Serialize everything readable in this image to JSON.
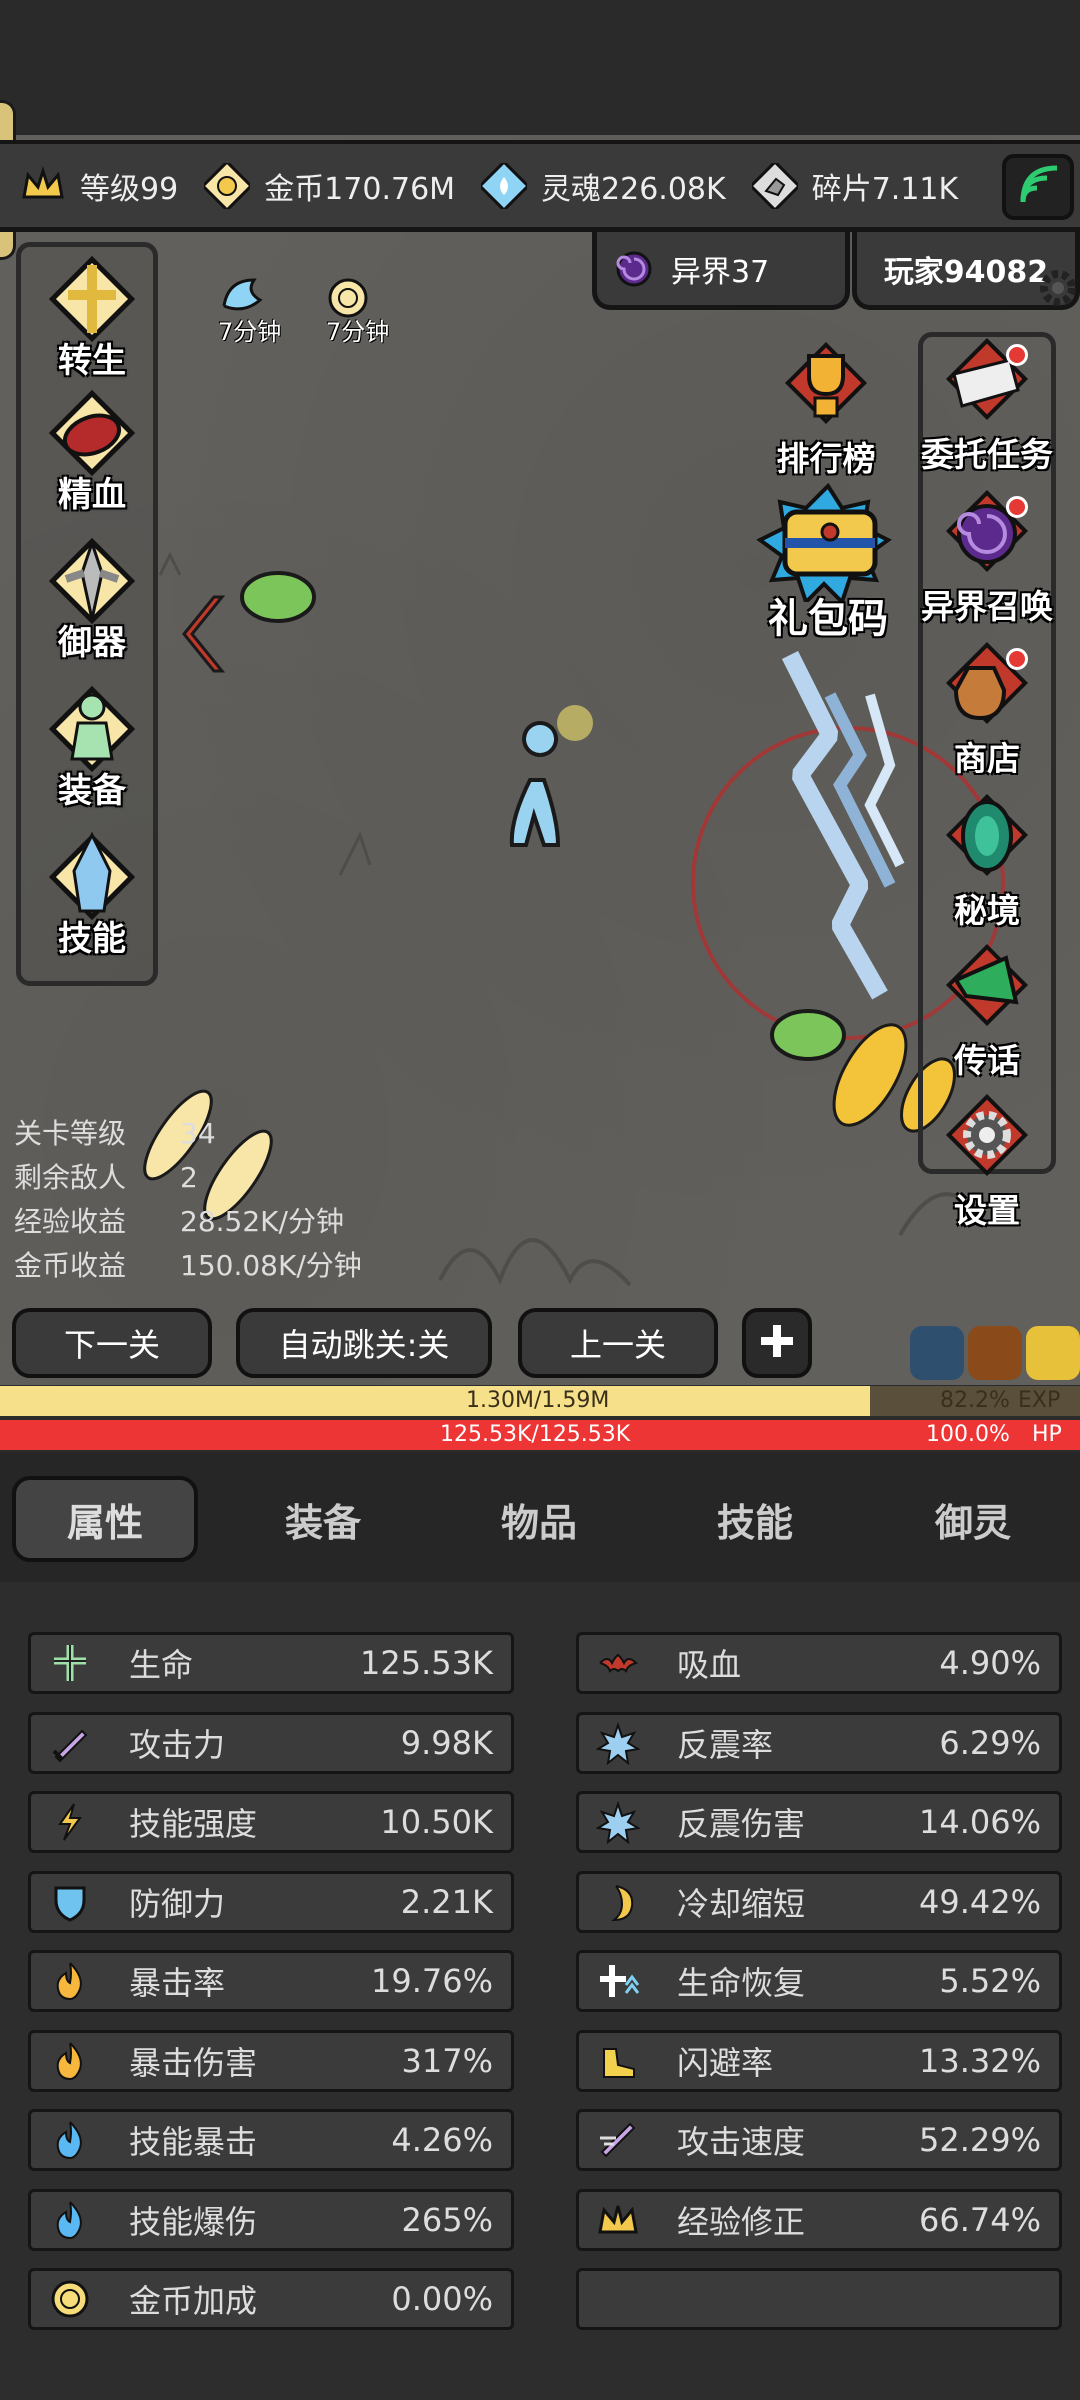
{
  "resources": {
    "level": "等级99",
    "gold": "金币170.76M",
    "soul": "灵魂226.08K",
    "shard": "碎片7.11K"
  },
  "realm_tab": "异界37",
  "player_tab": "玩家94082",
  "timers": [
    "7分钟",
    "7分钟"
  ],
  "left_menu": [
    "转生",
    "精血",
    "御器",
    "装备",
    "技能"
  ],
  "right_menu": {
    "ranking": "排行榜",
    "giftcode": "礼包码",
    "tasks": "委托任务",
    "summon": "异界召唤",
    "shop": "商店",
    "secret": "秘境",
    "message": "传话",
    "settings": "设置"
  },
  "stage_info": [
    {
      "k": "关卡等级",
      "v": "34"
    },
    {
      "k": "剩余敌人",
      "v": "2"
    },
    {
      "k": "经验收益",
      "v": "28.52K/分钟"
    },
    {
      "k": "金币收益",
      "v": "150.08K/分钟"
    }
  ],
  "buttons": {
    "next": "下一关",
    "auto": "自动跳关:关",
    "prev": "上一关"
  },
  "exp": {
    "text": "1.30M/1.59M",
    "percent": "82.2%",
    "label": "EXP",
    "fraction": 0.822
  },
  "hp": {
    "text": "125.53K/125.53K",
    "percent": "100.0%",
    "label": "HP",
    "fraction": 1.0
  },
  "tabs": [
    "属性",
    "装备",
    "物品",
    "技能",
    "御灵"
  ],
  "stats_left": [
    {
      "name": "生命",
      "value": "125.53K",
      "icon": "life-icon"
    },
    {
      "name": "攻击力",
      "value": "9.98K",
      "icon": "sword-icon"
    },
    {
      "name": "技能强度",
      "value": "10.50K",
      "icon": "lightning-icon"
    },
    {
      "name": "防御力",
      "value": "2.21K",
      "icon": "shield-icon"
    },
    {
      "name": "暴击率",
      "value": "19.76%",
      "icon": "flame-icon"
    },
    {
      "name": "暴击伤害",
      "value": "317%",
      "icon": "flame-icon"
    },
    {
      "name": "技能暴击",
      "value": "4.26%",
      "icon": "blue-flame-icon"
    },
    {
      "name": "技能爆伤",
      "value": "265%",
      "icon": "blue-flame-icon"
    },
    {
      "name": "金币加成",
      "value": "0.00%",
      "icon": "coin-icon"
    }
  ],
  "stats_right": [
    {
      "name": "吸血",
      "value": "4.90%",
      "icon": "bat-icon"
    },
    {
      "name": "反震率",
      "value": "6.29%",
      "icon": "spike-icon"
    },
    {
      "name": "反震伤害",
      "value": "14.06%",
      "icon": "spike-icon"
    },
    {
      "name": "冷却缩短",
      "value": "49.42%",
      "icon": "cooldown-icon"
    },
    {
      "name": "生命恢复",
      "value": "5.52%",
      "icon": "regen-icon"
    },
    {
      "name": "闪避率",
      "value": "13.32%",
      "icon": "boot-icon"
    },
    {
      "name": "攻击速度",
      "value": "52.29%",
      "icon": "attack-speed-icon"
    },
    {
      "name": "经验修正",
      "value": "66.74%",
      "icon": "crown-icon"
    }
  ],
  "colors": {
    "exp": "#f6e08a",
    "hp": "#ee3535",
    "panel": "#3b3b3b"
  }
}
